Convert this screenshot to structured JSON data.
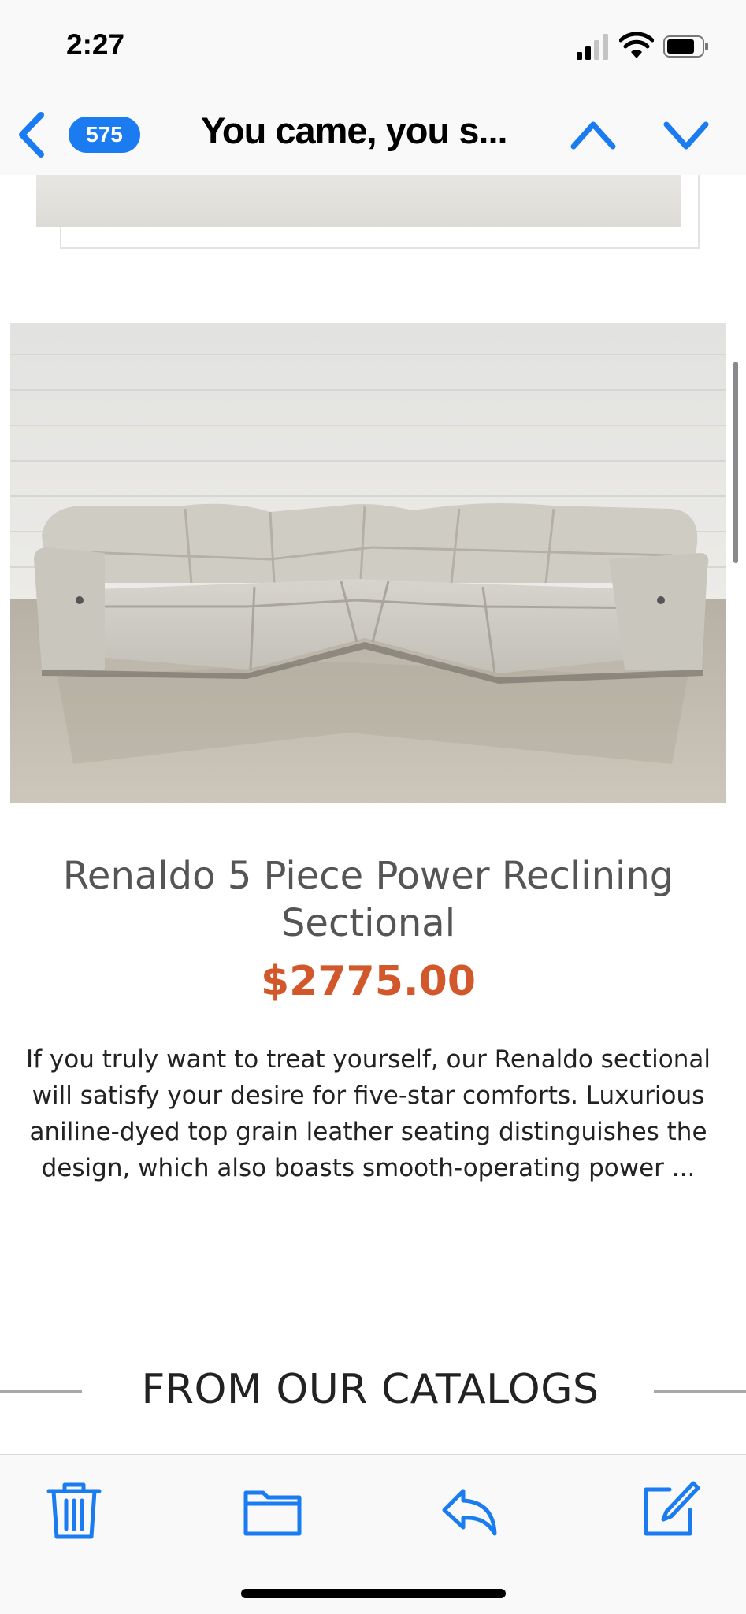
{
  "status_bar": {
    "time": "2:27",
    "icons": [
      "cellular-signal-icon",
      "wifi-icon",
      "battery-icon"
    ]
  },
  "nav_bar": {
    "back_icon": "chevron-left-icon",
    "unread_count": "575",
    "subject": "You came, you s...",
    "prev_icon": "chevron-up-icon",
    "next_icon": "chevron-down-icon",
    "accent_color": "#1b7cf2"
  },
  "email": {
    "product": {
      "title": "Renaldo 5 Piece Power Reclining Sectional",
      "price": "$2775.00",
      "price_color": "#d2582c",
      "description": "If you truly want to treat yourself, our Renaldo sectional will satisfy your desire for five-star comforts. Luxurious aniline-dyed top grain leather seating distinguishes the design, which also boasts smooth-operating power ..."
    },
    "section_heading": "FROM OUR CATALOGS"
  },
  "toolbar": {
    "buttons": [
      "trash-icon",
      "folder-icon",
      "reply-icon",
      "compose-icon"
    ]
  }
}
